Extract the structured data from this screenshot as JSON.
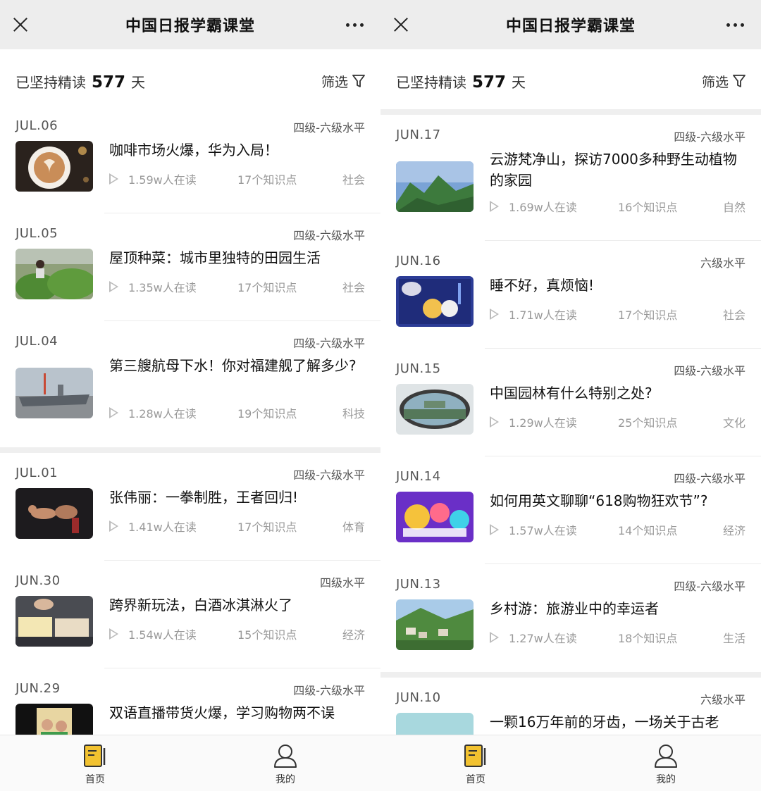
{
  "app": {
    "title": "中国日报学霸课堂",
    "streak_prefix": "已坚持精读",
    "streak_days": "577",
    "streak_suffix": "天",
    "filter_label": "筛选"
  },
  "left_screen": {
    "articles": [
      {
        "date": "JUL.06",
        "level": "四级-六级水平",
        "title": "咖啡市场火爆，华为入局！",
        "readers": "1.59w人在读",
        "points": "17个知识点",
        "category": "社会",
        "thumb_icon": "coffee-latte-photo"
      },
      {
        "date": "JUL.05",
        "level": "四级-六级水平",
        "title": "屋顶种菜：城市里独特的田园生活",
        "readers": "1.35w人在读",
        "points": "17个知识点",
        "category": "社会",
        "thumb_icon": "rooftop-garden-photo"
      },
      {
        "date": "JUL.04",
        "level": "四级-六级水平",
        "title": "第三艘航母下水！你对福建舰了解多少?",
        "readers": "1.28w人在读",
        "points": "19个知识点",
        "category": "科技",
        "thumb_icon": "aircraft-carrier-photo"
      },
      {
        "date": "JUL.01",
        "level": "四级-六级水平",
        "title": "张伟丽：一拳制胜，王者回归!",
        "readers": "1.41w人在读",
        "points": "17个知识点",
        "category": "体育",
        "thumb_icon": "mma-fight-photo"
      },
      {
        "date": "JUN.30",
        "level": "四级水平",
        "title": "跨界新玩法，白酒冰淇淋火了",
        "readers": "1.54w人在读",
        "points": "15个知识点",
        "category": "经济",
        "thumb_icon": "ice-cream-photo"
      },
      {
        "date": "JUN.29",
        "level": "四级-六级水平",
        "title": "双语直播带货火爆，学习购物两不误",
        "readers": "",
        "points": "",
        "category": "",
        "thumb_icon": "livestream-photo"
      }
    ]
  },
  "right_screen": {
    "articles": [
      {
        "date": "JUN.17",
        "level": "四级-六级水平",
        "title": "云游梵净山，探访7000多种野生动植物的家园",
        "readers": "1.69w人在读",
        "points": "16个知识点",
        "category": "自然",
        "thumb_icon": "mountain-photo"
      },
      {
        "date": "JUN.16",
        "level": "六级水平",
        "title": "睡不好，真烦恼!",
        "readers": "1.71w人在读",
        "points": "17个知识点",
        "category": "社会",
        "thumb_icon": "sleep-illustration"
      },
      {
        "date": "JUN.15",
        "level": "四级-六级水平",
        "title": "中国园林有什么特别之处?",
        "readers": "1.29w人在读",
        "points": "25个知识点",
        "category": "文化",
        "thumb_icon": "garden-window-photo"
      },
      {
        "date": "JUN.14",
        "level": "四级-六级水平",
        "title": "如何用英文聊聊“618购物狂欢节”?",
        "readers": "1.57w人在读",
        "points": "14个知识点",
        "category": "经济",
        "thumb_icon": "shopping-618-illustration"
      },
      {
        "date": "JUN.13",
        "level": "四级-六级水平",
        "title": "乡村游：旅游业中的幸运者",
        "readers": "1.27w人在读",
        "points": "18个知识点",
        "category": "生活",
        "thumb_icon": "village-photo"
      },
      {
        "date": "JUN.10",
        "level": "六级水平",
        "title": "一颗16万年前的牙齿，一场关于古老",
        "readers": "",
        "points": "",
        "category": "",
        "thumb_icon": "tooth-photo"
      }
    ]
  },
  "tabbar": {
    "home_label": "首页",
    "mine_label": "我的"
  },
  "colors": {
    "topbar_bg": "#ededed",
    "home_icon": "#f2c230",
    "muted_text": "#999999"
  }
}
